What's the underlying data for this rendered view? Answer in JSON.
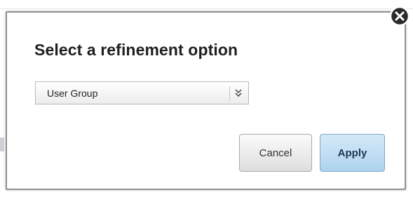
{
  "dialog": {
    "title": "Select a refinement option",
    "select": {
      "value": "User Group",
      "arrow_icon": "double-chevron-down-icon"
    },
    "buttons": {
      "cancel_label": "Cancel",
      "apply_label": "Apply"
    },
    "close_icon": "close-icon"
  },
  "colors": {
    "apply_button_bg": "#aed3ee",
    "cancel_button_bg": "#dedede",
    "dialog_border": "#8f8f8f",
    "close_icon_fill": "#2b2b2b"
  }
}
